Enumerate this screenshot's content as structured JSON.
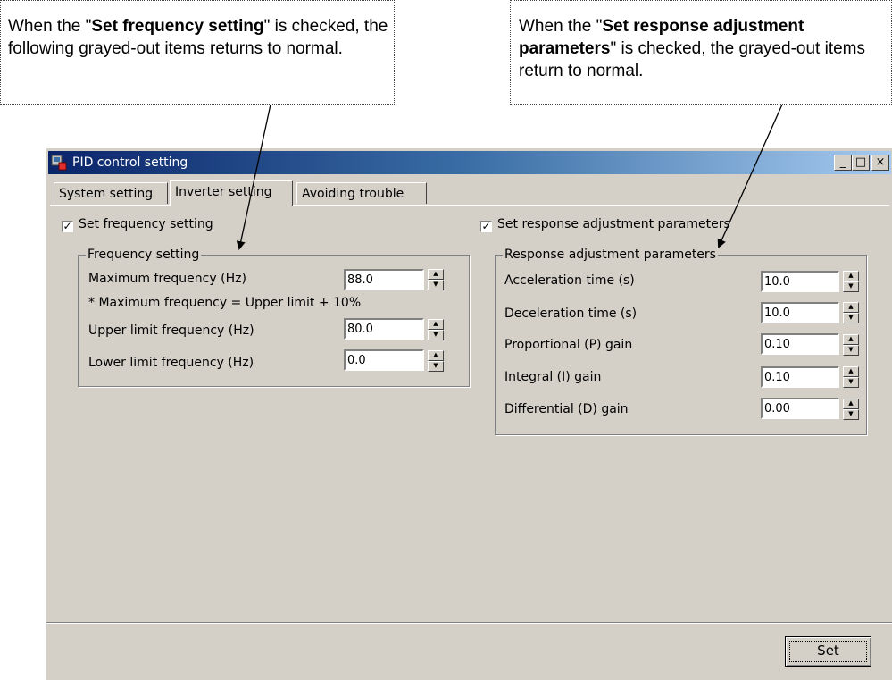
{
  "callouts": {
    "left": {
      "prefix": "When the \"",
      "bold": "Set frequency setting",
      "suffix": "\" is checked, the following grayed-out items returns to normal."
    },
    "right": {
      "prefix": "When the \"",
      "bold": "Set response adjustment parameters",
      "suffix": "\" is checked, the grayed-out items return to normal."
    }
  },
  "window": {
    "title": "PID control setting",
    "controls": {
      "minimize": "_",
      "maximize": "□",
      "close": "×"
    }
  },
  "tabs": [
    {
      "label": "System setting",
      "active": false
    },
    {
      "label": "Inverter setting",
      "active": true
    },
    {
      "label": "Avoiding trouble",
      "active": false
    }
  ],
  "frequency": {
    "checkbox_label": "Set frequency setting",
    "checked": "✓",
    "group_title": "Frequency setting",
    "max_label": "Maximum frequency (Hz)",
    "max_value": "88.0",
    "note": "* Maximum frequency = Upper limit + 10%",
    "upper_label": "Upper limit frequency (Hz)",
    "upper_value": "80.0",
    "lower_label": "Lower limit frequency (Hz)",
    "lower_value": "0.0"
  },
  "response": {
    "checkbox_label": "Set response adjustment parameters",
    "checked": "✓",
    "group_title": "Response adjustment parameters",
    "accel_label": "Acceleration time (s)",
    "accel_value": "10.0",
    "decel_label": "Deceleration time (s)",
    "decel_value": "10.0",
    "p_label": "Proportional (P) gain",
    "p_value": "0.10",
    "i_label": "Integral (I) gain",
    "i_value": "0.10",
    "d_label": "Differential (D) gain",
    "d_value": "0.00"
  },
  "buttons": {
    "set": "Set"
  },
  "spin": {
    "up": "▲",
    "down": "▼"
  }
}
